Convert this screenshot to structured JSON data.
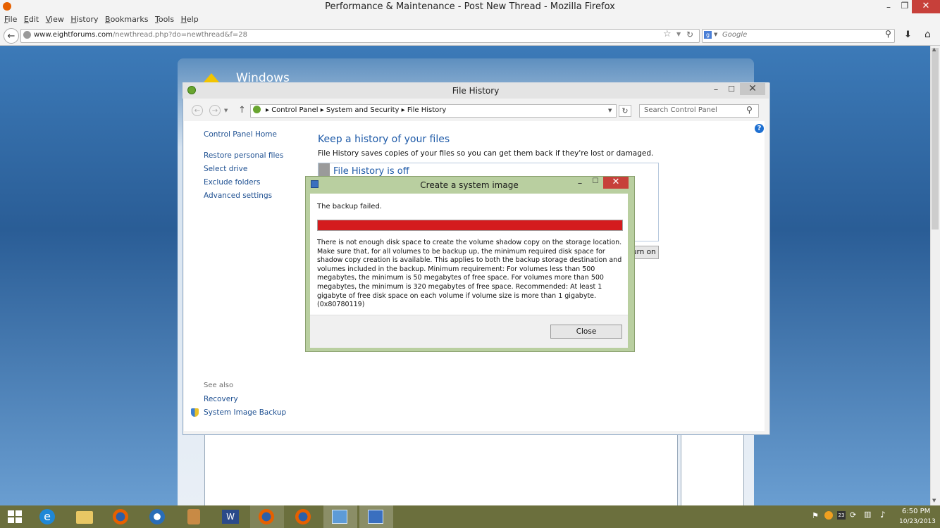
{
  "firefox": {
    "title": "Performance & Maintenance - Post New Thread - Mozilla Firefox",
    "menu": [
      "File",
      "Edit",
      "View",
      "History",
      "Bookmarks",
      "Tools",
      "Help"
    ],
    "url_domain": "www.eightforums.com",
    "url_path": "/newthread.php?do=newthread&f=28",
    "search_placeholder": "Google"
  },
  "forum": {
    "title": "Windows"
  },
  "file_history": {
    "title": "File History",
    "breadcrumb": [
      "Control Panel",
      "System and Security",
      "File History"
    ],
    "search_placeholder": "Search Control Panel",
    "sidebar": {
      "home": "Control Panel Home",
      "links": [
        "Restore personal files",
        "Select drive",
        "Exclude folders",
        "Advanced settings"
      ],
      "see_also_label": "See also",
      "see_also": [
        "Recovery",
        "System Image Backup"
      ]
    },
    "heading": "Keep a history of your files",
    "description": "File History saves copies of your files so you can get them back if they're lost or damaged.",
    "status": "File History is off",
    "turn_on_button": "Turn on"
  },
  "dialog": {
    "title": "Create a system image",
    "result": "The backup failed.",
    "progress": 1.0,
    "progress_color": "#d41b1e",
    "message": "There is not enough disk space to create the volume shadow copy on the storage location. Make sure that, for all volumes to be backup up, the minimum required disk space for shadow copy creation is available. This applies to both the backup storage destination and volumes included in the backup. Minimum requirement: For volumes less than 500 megabytes, the minimum is 50 megabytes of free space. For volumes more than 500 megabytes, the minimum is 320 megabytes of free space.  Recommended: At least 1 gigabyte of free disk space on each volume if volume size is more than 1 gigabyte. (0x80780119)",
    "close_button": "Close"
  },
  "taskbar": {
    "time": "6:50 PM",
    "date": "10/23/2013",
    "pinned": [
      "start-icon",
      "internet-explorer-icon",
      "file-explorer-icon",
      "firefox-icon",
      "thunderbird-icon",
      "app-icon",
      "word-icon",
      "firefox-icon",
      "firefox-icon",
      "control-panel-icon",
      "system-image-icon"
    ]
  }
}
